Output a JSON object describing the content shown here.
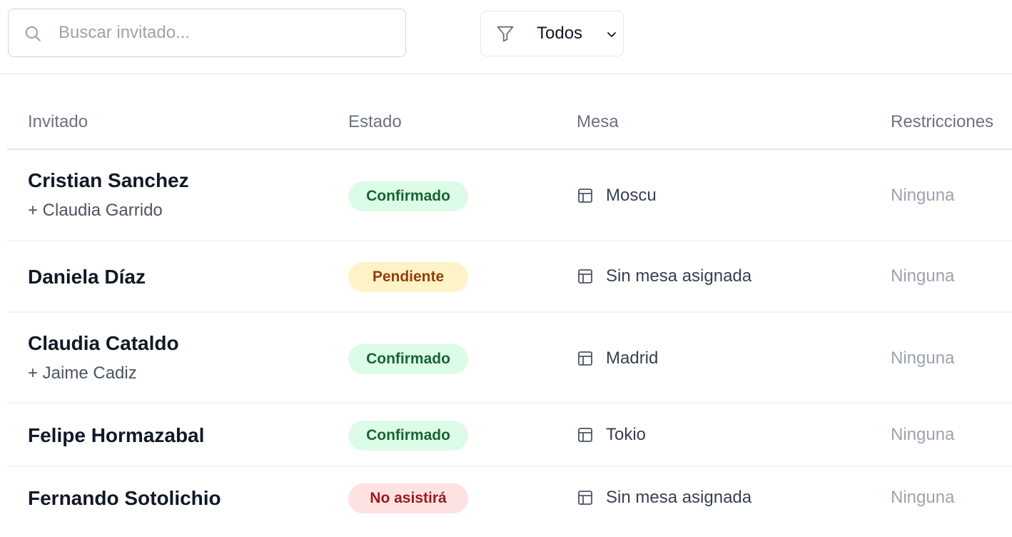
{
  "search": {
    "placeholder": "Buscar invitado...",
    "value": ""
  },
  "filter": {
    "selected": "Todos"
  },
  "table": {
    "headers": {
      "guest": "Invitado",
      "status": "Estado",
      "table": "Mesa",
      "restrictions": "Restricciones"
    },
    "rows": [
      {
        "name": "Cristian Sanchez",
        "companion": "+ Claudia Garrido",
        "status": "Confirmado",
        "status_kind": "confirmed",
        "table": "Moscu",
        "restrictions": "Ninguna"
      },
      {
        "name": "Daniela Díaz",
        "companion": "",
        "status": "Pendiente",
        "status_kind": "pending",
        "table": "Sin mesa asignada",
        "restrictions": "Ninguna"
      },
      {
        "name": "Claudia Cataldo",
        "companion": "+ Jaime Cadiz",
        "status": "Confirmado",
        "status_kind": "confirmed",
        "table": "Madrid",
        "restrictions": "Ninguna"
      },
      {
        "name": "Felipe Hormazabal",
        "companion": "",
        "status": "Confirmado",
        "status_kind": "confirmed",
        "table": "Tokio",
        "restrictions": "Ninguna"
      },
      {
        "name": "Fernando Sotolichio",
        "companion": "",
        "status": "No asistirá",
        "status_kind": "declined",
        "table": "Sin mesa asignada",
        "restrictions": "Ninguna"
      }
    ]
  },
  "icons": {
    "search": "search-icon",
    "filter": "filter-icon",
    "dropdown": "chevron-down-icon",
    "table": "table-icon"
  },
  "colors": {
    "confirmed_bg": "#dcfce7",
    "confirmed_text": "#166534",
    "pending_bg": "#fef3c7",
    "pending_text": "#92400e",
    "declined_bg": "#fee2e2",
    "declined_text": "#991b1b"
  }
}
